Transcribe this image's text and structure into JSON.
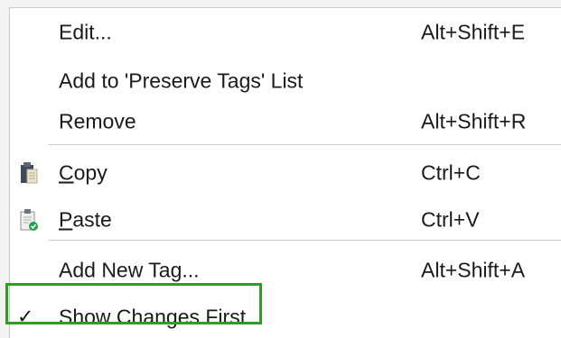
{
  "menu": {
    "items": [
      {
        "label": "Edit...",
        "shortcut": "Alt+Shift+E"
      },
      {
        "label": "Add to 'Preserve Tags' List",
        "shortcut": ""
      },
      {
        "label": "Remove",
        "shortcut": "Alt+Shift+R"
      },
      {
        "label": "Copy",
        "shortcut": "Ctrl+C",
        "icon": "clipboard-copy-icon"
      },
      {
        "label": "Paste",
        "shortcut": "Ctrl+V",
        "icon": "clipboard-paste-icon"
      },
      {
        "label": "Add New Tag...",
        "shortcut": "Alt+Shift+A"
      },
      {
        "label": "Show Changes First",
        "shortcut": "",
        "checked": true,
        "check_glyph": "✓"
      }
    ]
  },
  "colors": {
    "highlight_border": "#2e9e23",
    "separator": "#cfcfcf"
  }
}
